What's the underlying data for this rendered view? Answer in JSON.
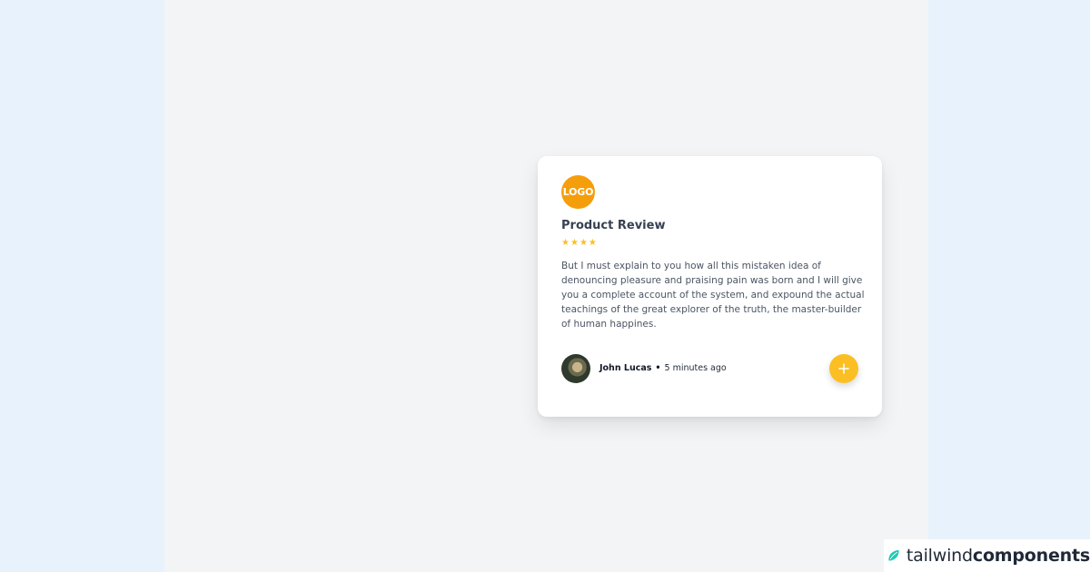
{
  "card": {
    "logo_text": "LOGO",
    "title": "Product Review",
    "rating": 4,
    "stars": [
      "★",
      "★",
      "★",
      "★"
    ],
    "body": "But I must explain to you how all this mistaken idea of denouncing pleasure and praising pain was born and I will give you a complete account of the system, and expound the actual teachings of the great explorer of the truth, the master-builder of human happines.",
    "author": "John Lucas",
    "separator": "•",
    "time": "5 minutes ago",
    "add_button_icon": "plus-icon"
  },
  "brand": {
    "name_light": "tailwind",
    "name_bold": "components",
    "icon": "leaf-icon"
  },
  "colors": {
    "accent": "#fbbf24",
    "logo_bg": "#f59e0b",
    "page_bg": "#e8f2fc",
    "stage_bg": "#f3f4f6"
  }
}
